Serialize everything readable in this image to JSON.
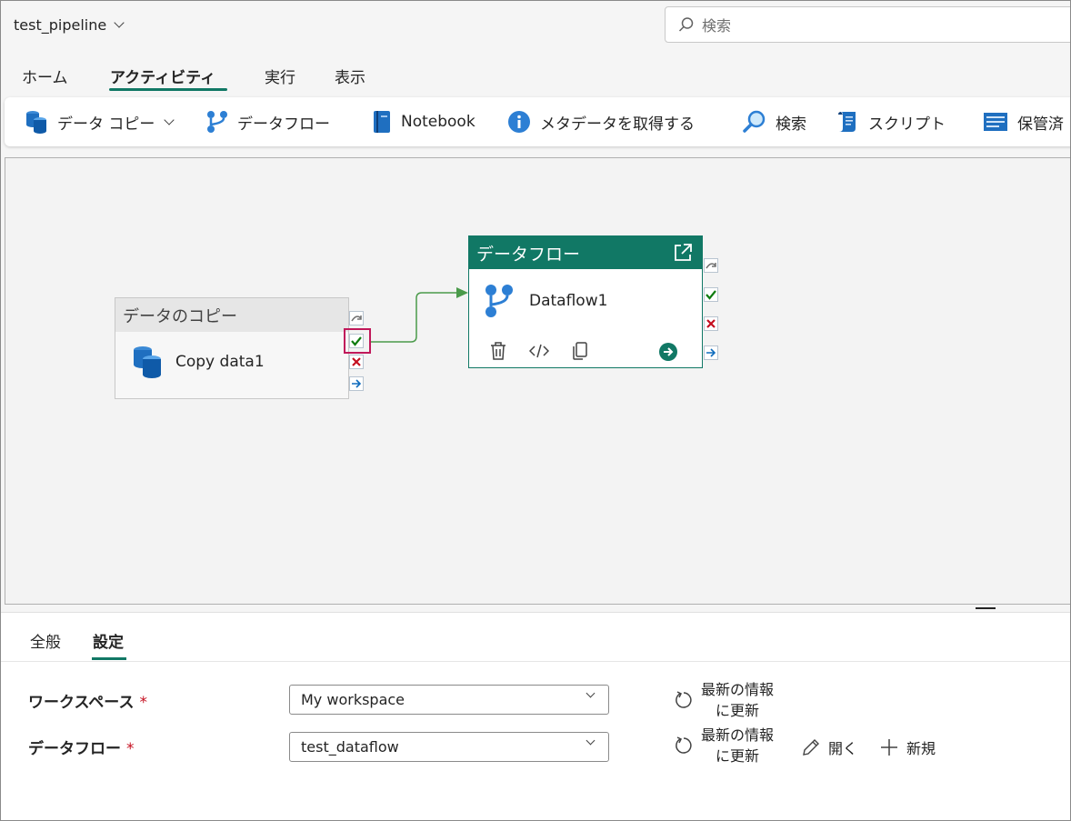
{
  "header": {
    "pipeline_name": "test_pipeline",
    "search_placeholder": "検索"
  },
  "tabs": {
    "home": "ホーム",
    "activities": "アクティビティ",
    "run": "実行",
    "view": "表示"
  },
  "toolbar": {
    "copy_data": "データ コピー",
    "dataflow": "データフロー",
    "notebook": "Notebook",
    "get_metadata": "メタデータを取得する",
    "lookup": "検索",
    "script": "スクリプト",
    "stored_procedure": "保管済"
  },
  "canvas": {
    "copy_activity": {
      "type_label": "データのコピー",
      "name": "Copy data1"
    },
    "dataflow_activity": {
      "type_label": "データフロー",
      "name": "Dataflow1"
    }
  },
  "panel": {
    "tabs": {
      "general": "全般",
      "settings": "設定"
    },
    "workspace": {
      "label": "ワークスペース",
      "required": "*",
      "value": "My workspace"
    },
    "dataflow": {
      "label": "データフロー",
      "required": "*",
      "value": "test_dataflow"
    },
    "refresh_line1": "最新の情報",
    "refresh_line2": "に更新",
    "open": "開く",
    "new": "新規"
  },
  "colors": {
    "accent": "#117865",
    "highlight": "#c0185a",
    "success": "#107c10",
    "failure": "#c50f1f",
    "info": "#0f6cbd"
  }
}
